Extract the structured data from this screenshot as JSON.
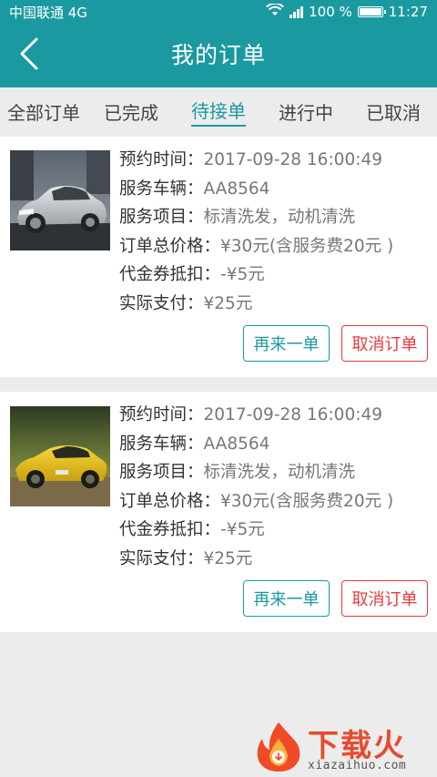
{
  "status_bar": {
    "carrier": "中国联通 4G",
    "battery": "100 %",
    "time": "11:27",
    "battery_level": 1.0,
    "icons": [
      "wifi-icon",
      "signal-icon",
      "battery-icon"
    ]
  },
  "nav": {
    "title": "我的订单",
    "back_icon": "chevron-left-icon"
  },
  "tabs": [
    {
      "label": "全部订单",
      "active": false
    },
    {
      "label": "已完成",
      "active": false
    },
    {
      "label": "待接单",
      "active": true
    },
    {
      "label": "进行中",
      "active": false
    },
    {
      "label": "已取消",
      "active": false
    }
  ],
  "orders": [
    {
      "image": "silver-sedan-photo",
      "lines": [
        {
          "label": "预约时间：",
          "value": "2017-09-28  16:00:49"
        },
        {
          "label": "服务车辆：",
          "value": "AA8564"
        },
        {
          "label": "服务项目：",
          "value": "标清洗发，动机清洗"
        },
        {
          "label": "订单总价格：",
          "value": "¥30元(含服务费20元 )"
        },
        {
          "label": "代金券抵扣：",
          "value": "-¥5元"
        },
        {
          "label": "实际支付：",
          "value": "¥25元"
        }
      ],
      "reorder_label": "再来一单",
      "cancel_label": "取消订单"
    },
    {
      "image": "yellow-sports-car-photo",
      "lines": [
        {
          "label": "预约时间：",
          "value": "2017-09-28  16:00:49"
        },
        {
          "label": "服务车辆：",
          "value": "AA8564"
        },
        {
          "label": "服务项目：",
          "value": "标清洗发，动机清洗"
        },
        {
          "label": "订单总价格：",
          "value": "¥30元(含服务费20元 )"
        },
        {
          "label": "代金券抵扣：",
          "value": "-¥5元"
        },
        {
          "label": "实际支付：",
          "value": "¥25元"
        }
      ],
      "reorder_label": "再来一单",
      "cancel_label": "取消订单"
    }
  ],
  "watermark": {
    "brand": "下载火",
    "url": "xiazaihuo.com"
  },
  "colors": {
    "primary": "#1a9aa0",
    "danger": "#e8393d",
    "background": "#ececec"
  }
}
